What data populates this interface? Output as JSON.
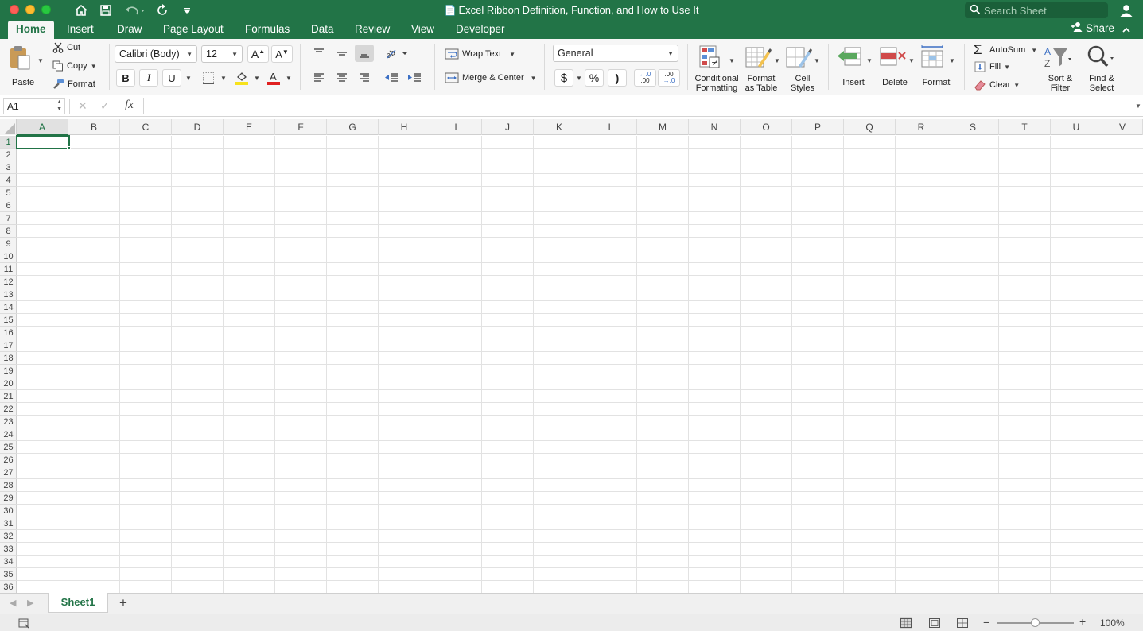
{
  "window": {
    "title": "Excel Ribbon Definition, Function, and How to Use It"
  },
  "search": {
    "placeholder": "Search Sheet"
  },
  "tabs": [
    "Home",
    "Insert",
    "Draw",
    "Page Layout",
    "Formulas",
    "Data",
    "Review",
    "View",
    "Developer"
  ],
  "share_label": "Share",
  "clipboard": {
    "paste": "Paste",
    "cut": "Cut",
    "copy": "Copy",
    "format": "Format"
  },
  "font": {
    "name": "Calibri (Body)",
    "size": "12",
    "bold": "B",
    "italic": "I",
    "underline": "U"
  },
  "alignment": {
    "wrap_text": "Wrap Text",
    "merge_center": "Merge & Center"
  },
  "number": {
    "format": "General",
    "currency": "$",
    "percent": "%",
    "comma": ")",
    "inc_decimal_top": "←.0",
    "inc_decimal_bottom": ".00",
    "dec_decimal_top": ".00",
    "dec_decimal_bottom": "→.0"
  },
  "styles": {
    "conditional_1": "Conditional",
    "conditional_2": "Formatting",
    "table_1": "Format",
    "table_2": "as Table",
    "cell_1": "Cell",
    "cell_2": "Styles"
  },
  "cells": {
    "insert": "Insert",
    "delete": "Delete",
    "format": "Format"
  },
  "editing": {
    "autosum": "AutoSum",
    "fill": "Fill",
    "clear": "Clear",
    "sort_1": "Sort &",
    "sort_2": "Filter",
    "find_1": "Find &",
    "find_2": "Select"
  },
  "formula_bar": {
    "name_box": "A1",
    "fx": "fx"
  },
  "columns": [
    "A",
    "B",
    "C",
    "D",
    "E",
    "F",
    "G",
    "H",
    "I",
    "J",
    "K",
    "L",
    "M",
    "N",
    "O",
    "P",
    "Q",
    "R",
    "S",
    "T",
    "U",
    "V"
  ],
  "rows": [
    "1",
    "2",
    "3",
    "4",
    "5",
    "6",
    "7",
    "8",
    "9",
    "10",
    "11",
    "12",
    "13",
    "14",
    "15",
    "16",
    "17",
    "18",
    "19",
    "20",
    "21",
    "22",
    "23",
    "24",
    "25",
    "26",
    "27",
    "28",
    "29",
    "30",
    "31",
    "32",
    "33",
    "34",
    "35",
    "36"
  ],
  "selected_cell": {
    "column": "A",
    "row": "1"
  },
  "sheets": [
    "Sheet1"
  ],
  "add_sheet": "+",
  "status": {
    "zoom": "100%",
    "zoom_level": 0.5
  },
  "colors": {
    "accent": "#227447",
    "selection": "#217346",
    "font_color": "#e02020",
    "highlight": "#f7e21c"
  }
}
